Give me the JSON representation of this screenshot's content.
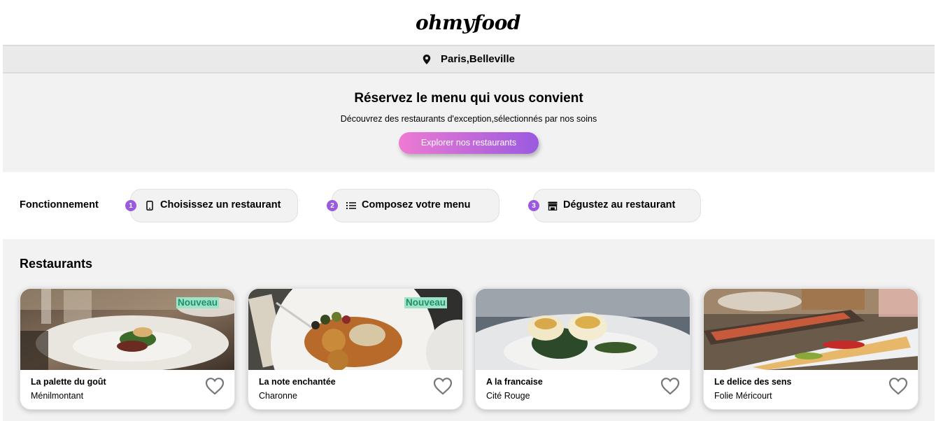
{
  "brand": {
    "logo": "ohmyfood"
  },
  "location": {
    "city": "Paris,Belleville",
    "icon": "location-pin-icon"
  },
  "hero": {
    "title": "Réservez le menu qui vous convient",
    "subtitle": "Découvrez des restaurants d'exception,sélectionnés par nos soins",
    "cta_label": "Explorer nos restaurants"
  },
  "how": {
    "title": "Fonctionnement",
    "steps": [
      {
        "number": "1",
        "icon": "mobile-phone-icon",
        "label": "Choisissez un restaurant"
      },
      {
        "number": "2",
        "icon": "list-icon",
        "label": "Composez votre menu"
      },
      {
        "number": "3",
        "icon": "storefront-icon",
        "label": "Dégustez au restaurant"
      }
    ]
  },
  "restaurants": {
    "title": "Restaurants",
    "items": [
      {
        "name": "La palette du goût",
        "area": "Ménilmontant",
        "badge": "Nouveau"
      },
      {
        "name": "La note enchantée",
        "area": "Charonne",
        "badge": "Nouveau"
      },
      {
        "name": "A la francaise",
        "area": "Cité Rouge",
        "badge": ""
      },
      {
        "name": "Le delice des sens",
        "area": "Folie Méricourt",
        "badge": ""
      }
    ]
  },
  "colors": {
    "accent_pink": "#ee7ad3",
    "accent_purple": "#9a5ae0",
    "badge_bg": "#9de3c8",
    "badge_text": "#1f8f6a",
    "section_bg": "#f2f2f2"
  }
}
